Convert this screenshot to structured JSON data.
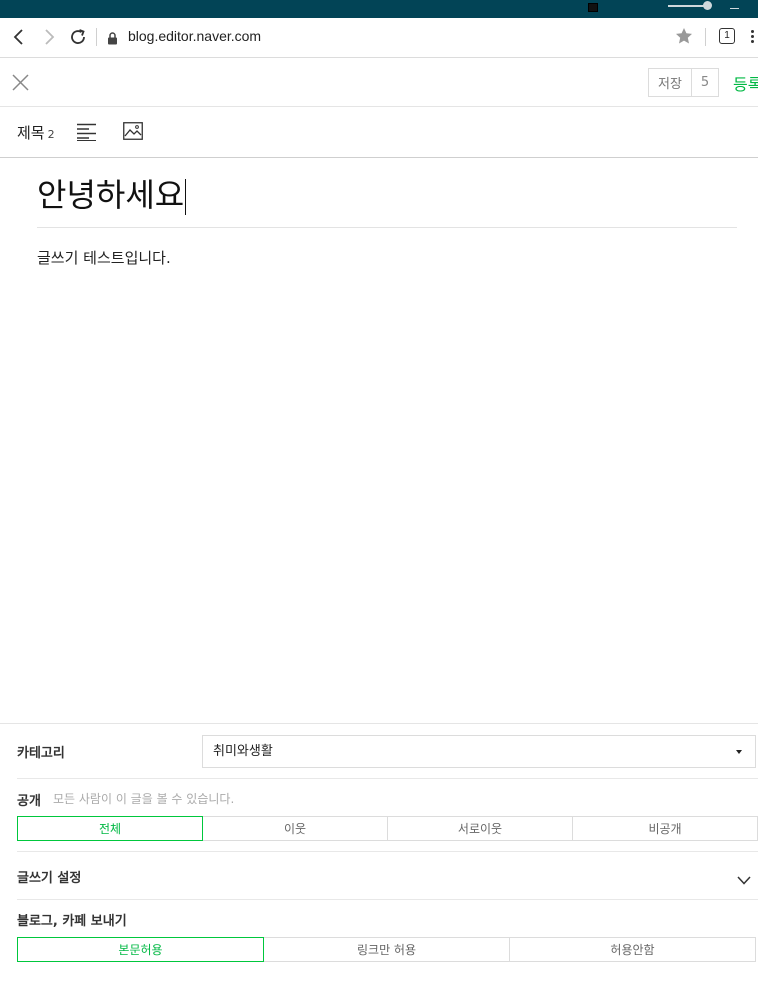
{
  "browser": {
    "url": "blog.editor.naver.com",
    "tab_count": "1"
  },
  "header": {
    "save_label": "저장",
    "save_count": "5",
    "publish_label": "등록"
  },
  "toolbar": {
    "title_label": "제목",
    "title_sub": "2"
  },
  "editor": {
    "title": "안녕하세요",
    "body": "글쓰기 테스트입니다."
  },
  "settings": {
    "category_label": "카테고리",
    "category_value": "취미와생활",
    "visibility_label": "공개",
    "visibility_desc": "모든 사람이 이 글을 볼 수 있습니다.",
    "visibility_options": [
      "전체",
      "이웃",
      "서로이웃",
      "비공개"
    ],
    "write_settings_label": "글쓰기 설정",
    "send_label": "블로그, 카페 보내기",
    "send_options": [
      "본문허용",
      "링크만 허용",
      "허용안함"
    ]
  },
  "colors": {
    "accent": "#00c73c",
    "titlebar": "#024456"
  }
}
